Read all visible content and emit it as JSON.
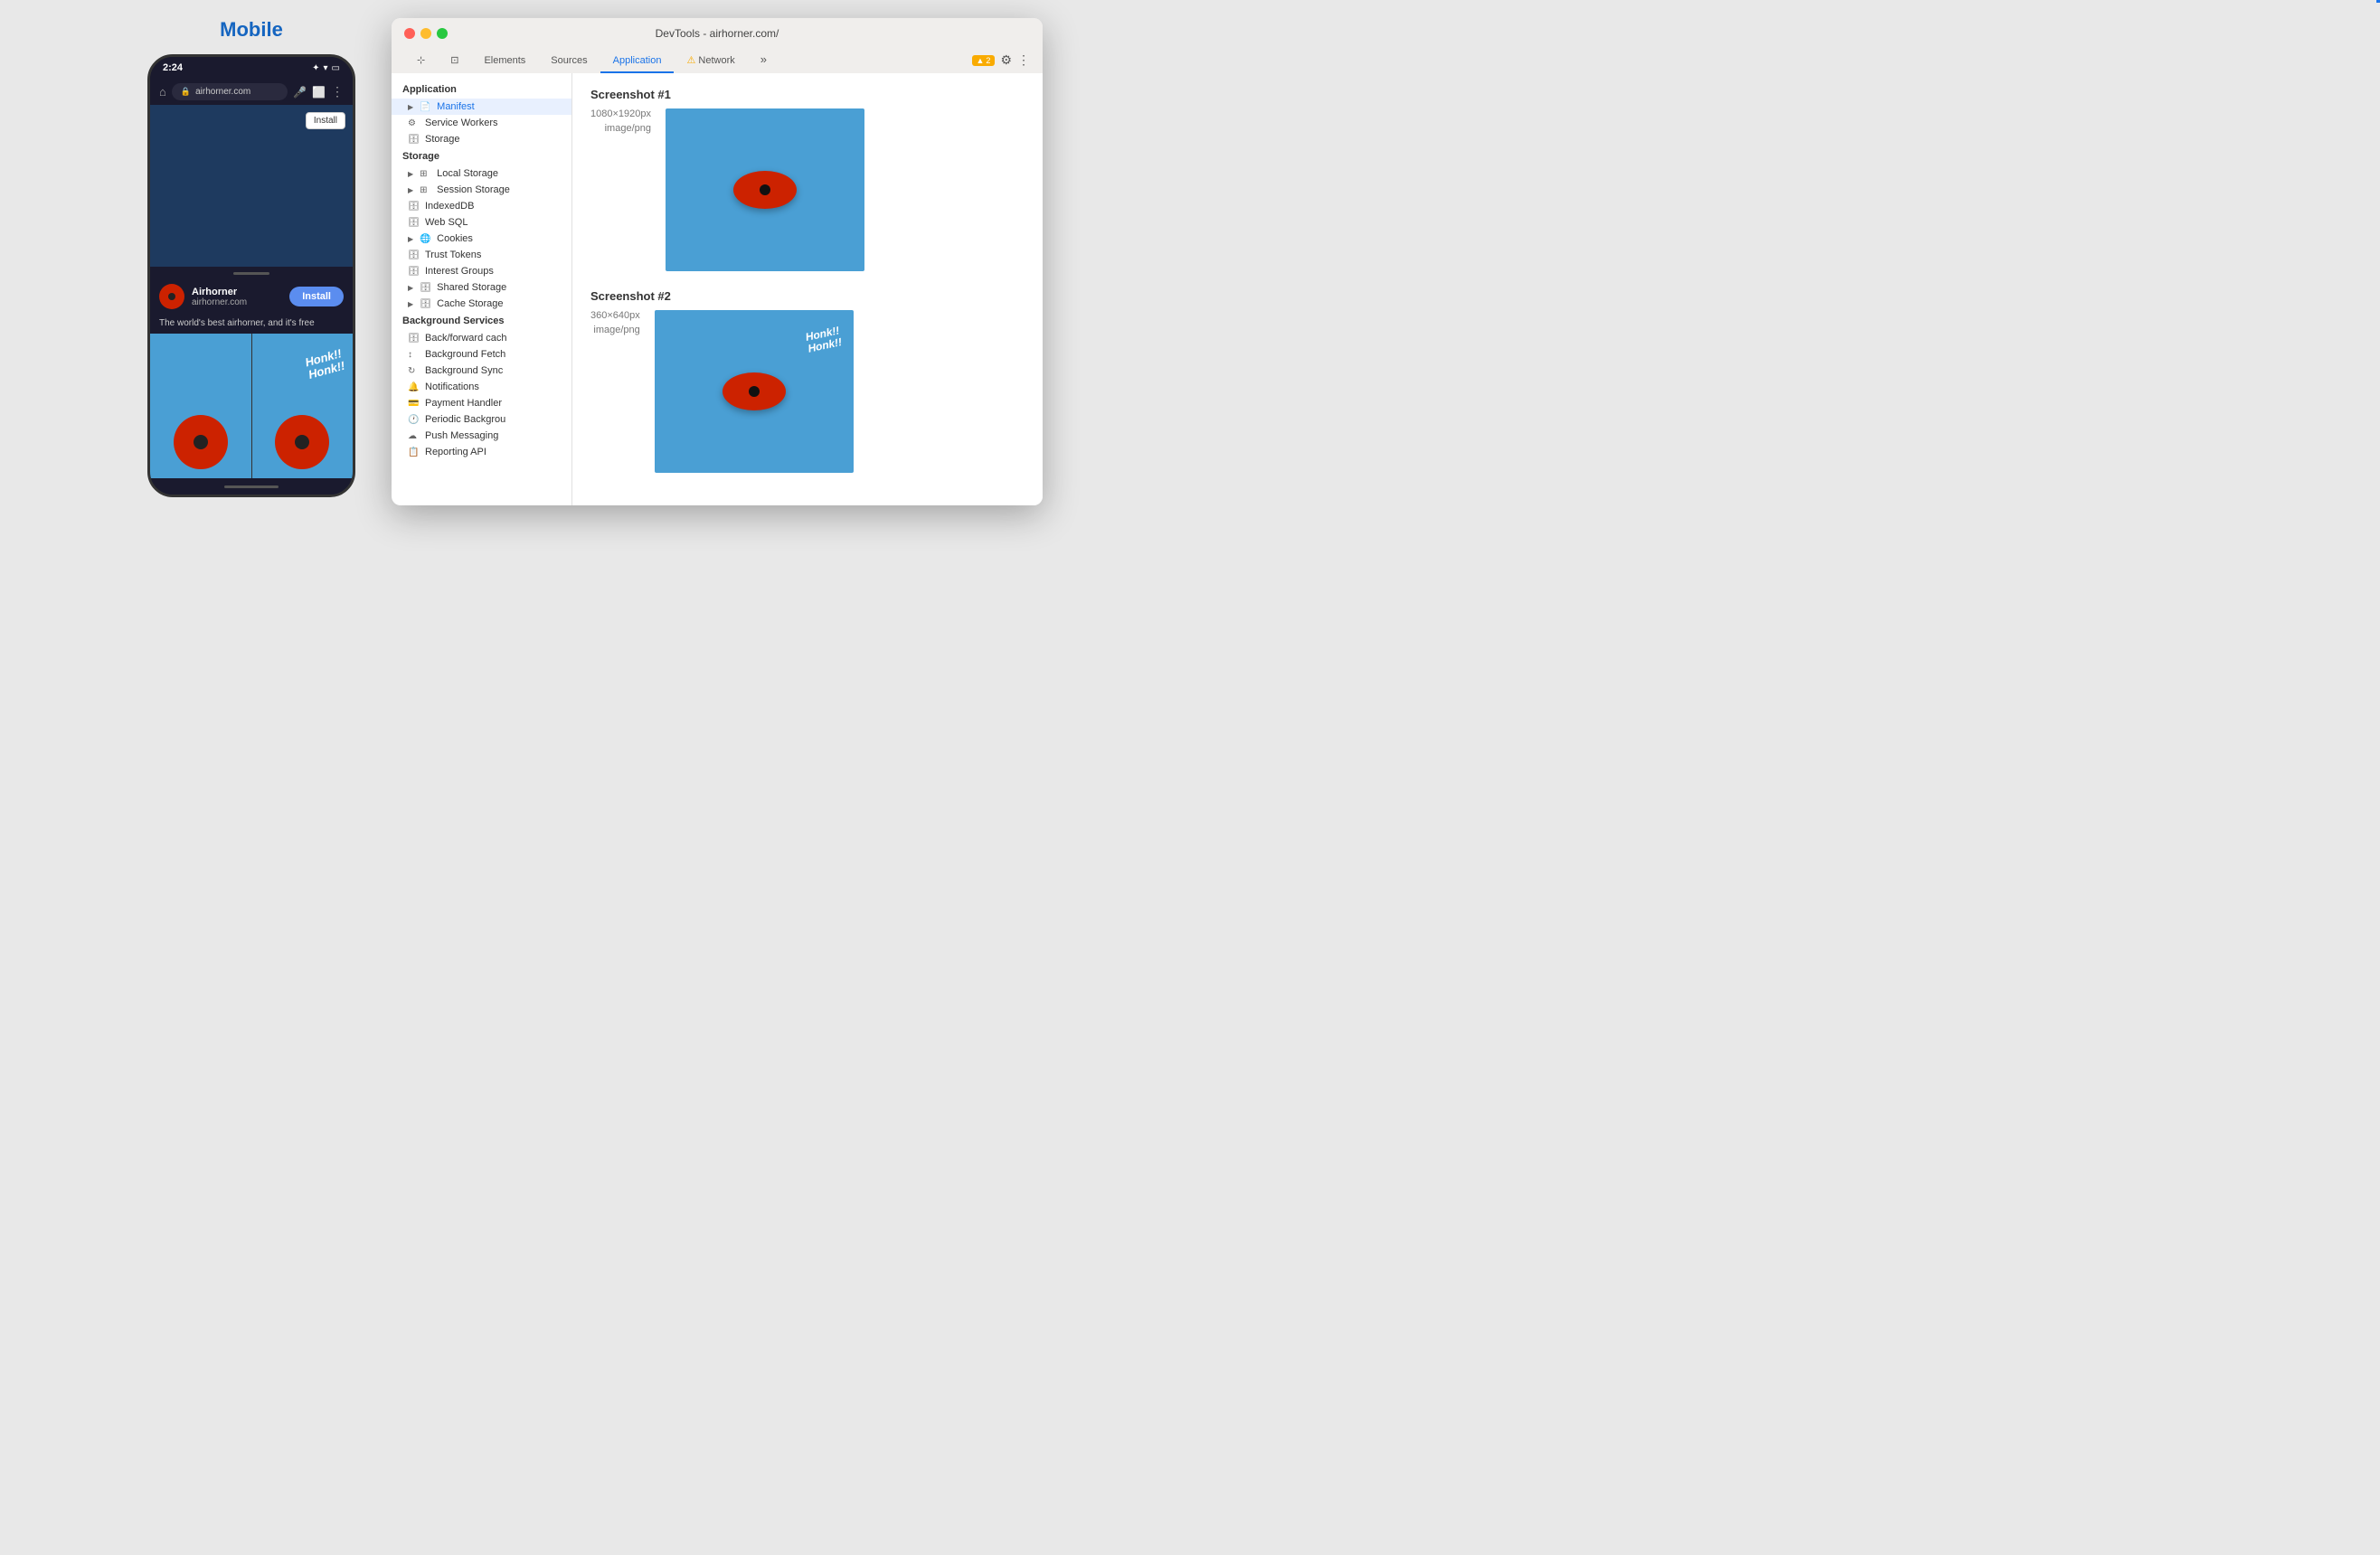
{
  "mobile": {
    "label": "Mobile",
    "status_time": "2:24",
    "url": "airhorner.com",
    "install_btn": "Install",
    "app_name": "Airhorner",
    "app_domain": "airhorner.com",
    "install_btn_prompt": "Install",
    "tagline": "The world's best airhorner, and it's free",
    "honk_text_line1": "Honk!!",
    "honk_text_line2": "Honk!!"
  },
  "devtools": {
    "title": "DevTools - airhorner.com/",
    "tabs": [
      {
        "label": "Elements",
        "active": false
      },
      {
        "label": "Sources",
        "active": false
      },
      {
        "label": "Application",
        "active": true
      },
      {
        "label": "⚠ Network",
        "active": false
      },
      {
        "label": "»",
        "active": false
      }
    ],
    "warning_count": "▲ 2",
    "sidebar": {
      "app_section": "Application",
      "app_items": [
        {
          "label": "Manifest",
          "icon": "📄",
          "expandable": true
        },
        {
          "label": "Service Workers",
          "icon": "⚙️"
        },
        {
          "label": "Storage",
          "icon": "🗄"
        }
      ],
      "storage_section": "Storage",
      "storage_items": [
        {
          "label": "Local Storage",
          "icon": "⊞",
          "expandable": true
        },
        {
          "label": "Session Storage",
          "icon": "⊞",
          "expandable": true
        },
        {
          "label": "IndexedDB",
          "icon": "🗄"
        },
        {
          "label": "Web SQL",
          "icon": "🗄"
        },
        {
          "label": "Cookies",
          "icon": "🌐",
          "expandable": true
        },
        {
          "label": "Trust Tokens",
          "icon": "🗄"
        },
        {
          "label": "Interest Groups",
          "icon": "🗄"
        },
        {
          "label": "Shared Storage",
          "icon": "🗄",
          "expandable": true
        },
        {
          "label": "Cache Storage",
          "icon": "🗄",
          "expandable": true
        }
      ],
      "bg_section": "Background Services",
      "bg_items": [
        {
          "label": "Back/forward cach",
          "icon": "🗄"
        },
        {
          "label": "Background Fetch",
          "icon": "↕"
        },
        {
          "label": "Background Sync",
          "icon": "↻"
        },
        {
          "label": "Notifications",
          "icon": "🔔"
        },
        {
          "label": "Payment Handler",
          "icon": "💳"
        },
        {
          "label": "Periodic Backgrou",
          "icon": "🕐"
        },
        {
          "label": "Push Messaging",
          "icon": "☁"
        },
        {
          "label": "Reporting API",
          "icon": "📋"
        }
      ]
    },
    "main": {
      "screenshot1": {
        "title": "Screenshot #1",
        "dims": "1080×1920px",
        "type": "image/png"
      },
      "screenshot2": {
        "title": "Screenshot #2",
        "dims": "360×640px",
        "type": "image/png"
      }
    }
  }
}
